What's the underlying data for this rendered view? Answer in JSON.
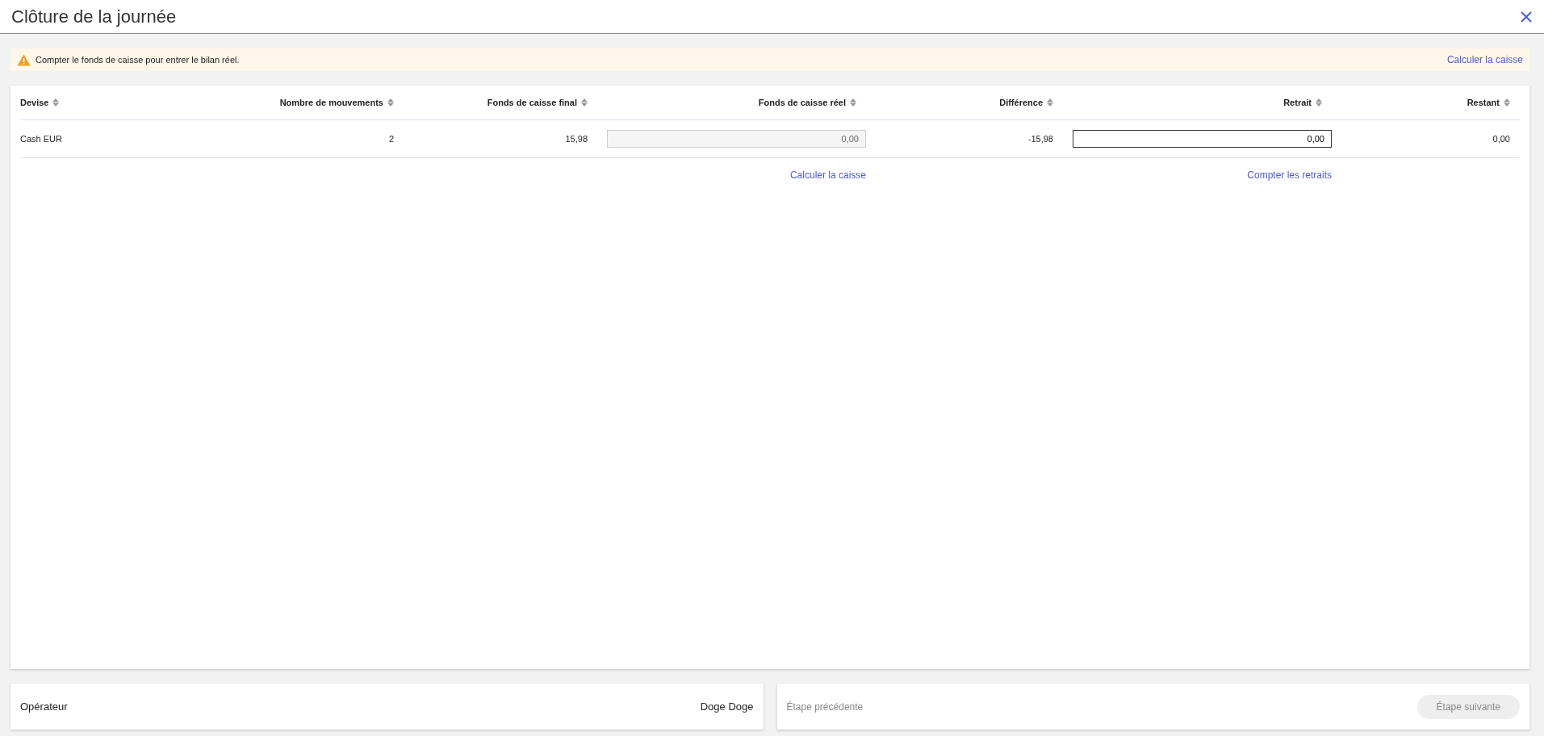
{
  "window": {
    "title": "Clôture de la journée"
  },
  "alert": {
    "message": "Compter le fonds de caisse pour entrer le bilan réel.",
    "link": "Calculer la caisse"
  },
  "table": {
    "columns": [
      {
        "label": "Devise"
      },
      {
        "label": "Nombre de mouvements"
      },
      {
        "label": "Fonds de caisse final"
      },
      {
        "label": "Fonds de caisse réel"
      },
      {
        "label": "Différence"
      },
      {
        "label": "Retrait"
      },
      {
        "label": "Restant"
      }
    ],
    "rows": [
      {
        "devise": "Cash EUR",
        "mouvements": "2",
        "final": "15,98",
        "reel": {
          "value": "0,00",
          "disabled": true
        },
        "difference": "-15,98",
        "retrait": {
          "value": "0,00",
          "disabled": false
        },
        "restant": "0,00"
      }
    ],
    "actions": [
      {
        "label": "Calculer la caisse"
      },
      {
        "label": "Compter les retraits"
      }
    ]
  },
  "operator": {
    "label": "Opérateur",
    "name": "Doge Doge"
  },
  "steps": {
    "previous": {
      "label": "Étape précédente",
      "disabled": true
    },
    "next": {
      "label": "Étape suivante",
      "disabled": true
    }
  }
}
